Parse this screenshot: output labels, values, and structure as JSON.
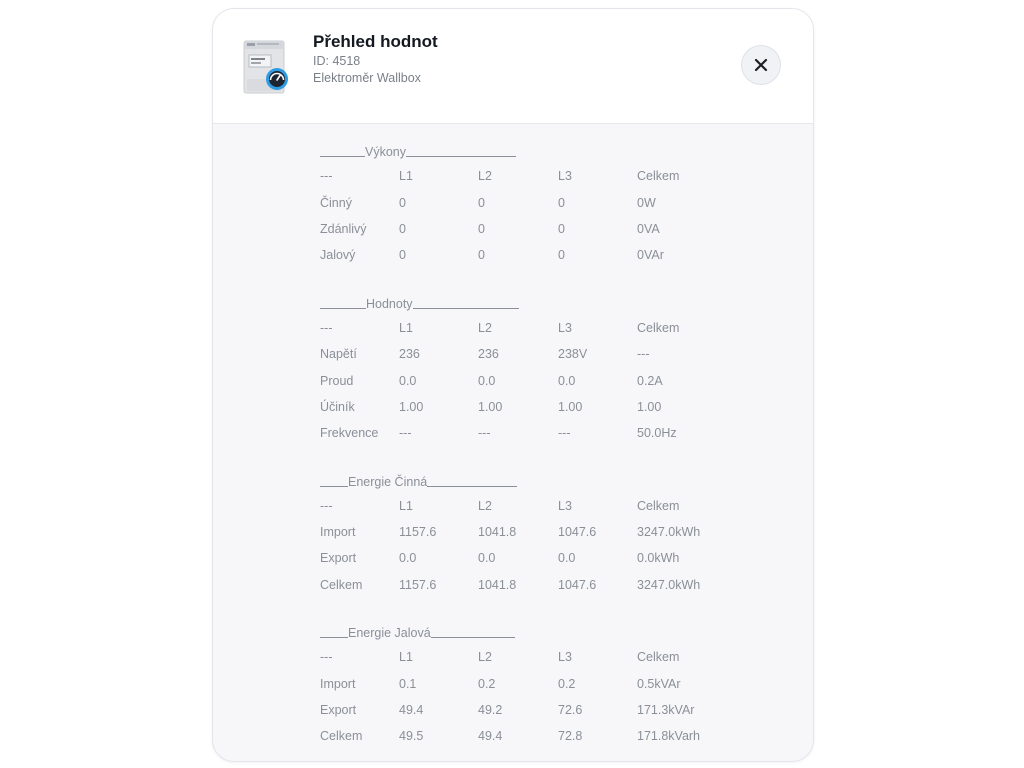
{
  "header": {
    "title": "Přehled hodnot",
    "id_line": "ID: 4518",
    "device_name": "Elektroměr Wallbox",
    "device_image": "din-rail-energy-meter-icon",
    "close_icon": "close-icon"
  },
  "sections": [
    {
      "title": "Výkony",
      "rows": [
        [
          "---",
          "L1",
          "L2",
          "L3",
          "Celkem"
        ],
        [
          "Činný",
          "0",
          "0",
          "0",
          "0W"
        ],
        [
          "Zdánlivý",
          "0",
          "0",
          "0",
          "0VA"
        ],
        [
          "Jalový",
          "0",
          "0",
          "0",
          "0VAr"
        ]
      ]
    },
    {
      "title": "Hodnoty",
      "rows": [
        [
          "---",
          "L1",
          "L2",
          "L3",
          "Celkem"
        ],
        [
          "Napětí",
          "236",
          "236",
          "238V",
          "---"
        ],
        [
          "Proud",
          "0.0",
          "0.0",
          "0.0",
          "0.2A"
        ],
        [
          "Účiník",
          "1.00",
          "1.00",
          "1.00",
          "1.00"
        ],
        [
          "Frekvence",
          "---",
          "---",
          "---",
          "50.0Hz"
        ]
      ]
    },
    {
      "title": "Energie Činná",
      "rows": [
        [
          "---",
          "L1",
          "L2",
          "L3",
          "Celkem"
        ],
        [
          "Import",
          "1157.6",
          "1041.8",
          "1047.6",
          "3247.0kWh"
        ],
        [
          "Export",
          "0.0",
          "0.0",
          "0.0",
          "0.0kWh"
        ],
        [
          "Celkem",
          "1157.6",
          "1041.8",
          "1047.6",
          "3247.0kWh"
        ]
      ]
    },
    {
      "title": "Energie Jalová",
      "rows": [
        [
          "---",
          "L1",
          "L2",
          "L3",
          "Celkem"
        ],
        [
          "Import",
          "0.1",
          "0.2",
          "0.2",
          "0.5kVAr"
        ],
        [
          "Export",
          "49.4",
          "49.2",
          "72.6",
          "171.3kVAr"
        ],
        [
          "Celkem",
          "49.5",
          "49.4",
          "72.8",
          "171.8kVarh"
        ]
      ]
    }
  ],
  "colors": {
    "text_primary": "#141821",
    "text_muted": "#8a8f98",
    "panel_bg": "#f7f7f9",
    "gauge_accent": "#2f9be0"
  }
}
